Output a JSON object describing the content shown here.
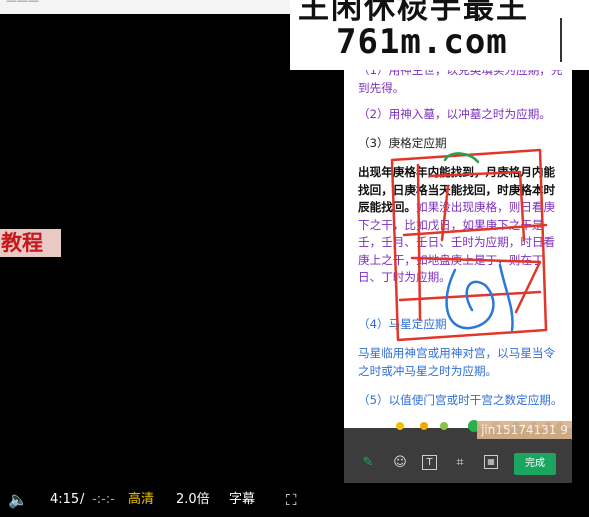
{
  "topbar": {
    "text": "———"
  },
  "side_label": "教程",
  "banner": {
    "line1": "王闲休棂手最王",
    "line2": "761m.com"
  },
  "document": {
    "para1": "（1）用神生世，以克英填实为应期，先到先得。",
    "para2": "（2）用神入墓，以冲墓之时为应期。",
    "para3": "（3）庚格定应期",
    "para4_black": "出现年庚格年内能找到，月庚格月内能找回，日庚格当天能找回，时庚格本时辰能找回。",
    "para4_purple": "如果没出现庚格，则日看庚下之干，比如戊日，如果庚下之干是壬，壬月、壬日、壬时为应期，时日看庚上之干，如地盘庚上是丁，则在丁日、丁时为应期。",
    "para5": "（4）马星定应期",
    "para6": "马星临用神宫或用神对宫，以马星当令之时或冲马星之时为应期。",
    "para7": "（5）以值使门宫或时干宫之数定应期。"
  },
  "watermark": "jin15174131 9",
  "editor": {
    "done_label": "完成",
    "palette": [
      "#f0c000",
      "#f2a800",
      "#8ac24a",
      "#28b04a",
      "#2aa0e8",
      "#2f6dd8",
      "#8e44ad",
      "#7b2fbe",
      "#555555"
    ],
    "tool_icons": [
      "pen-icon",
      "emoji-icon",
      "text-icon",
      "crop-icon",
      "mosaic-icon"
    ]
  },
  "player": {
    "time_current": "4:15",
    "time_separator": "/",
    "time_total": "-:-:-",
    "quality": "高清",
    "speed": "2.0倍",
    "subtitles": "字幕"
  }
}
